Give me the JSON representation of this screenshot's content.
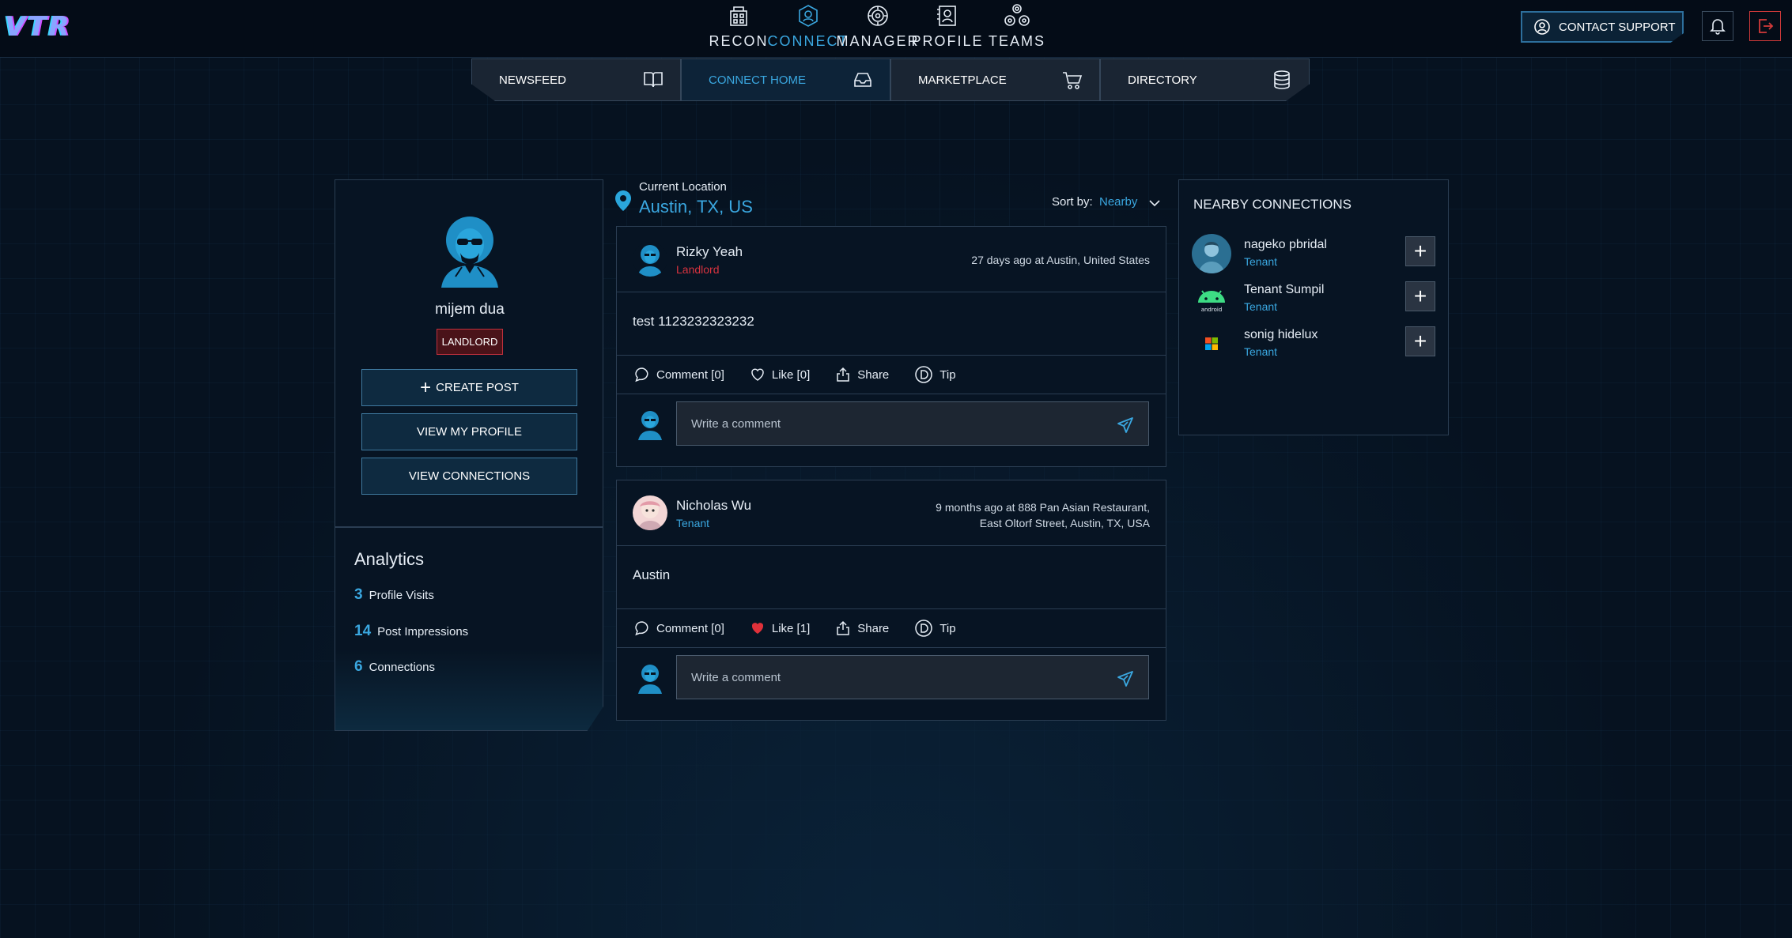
{
  "topbar": {
    "logo_text": "VTR",
    "nav": [
      {
        "label": "RECON",
        "icon": "building-icon",
        "active": false
      },
      {
        "label": "CONNECT",
        "icon": "connect-icon",
        "active": true
      },
      {
        "label": "MANAGER",
        "icon": "manager-icon",
        "active": false
      },
      {
        "label": "PROFILE",
        "icon": "profile-icon",
        "active": false
      },
      {
        "label": "TEAMS",
        "icon": "teams-icon",
        "active": false
      }
    ],
    "support_label": "CONTACT SUPPORT"
  },
  "subnav": [
    {
      "label": "NEWSFEED",
      "icon": "book-icon",
      "active": false
    },
    {
      "label": "CONNECT HOME",
      "icon": "inbox-icon",
      "active": true
    },
    {
      "label": "MARKETPLACE",
      "icon": "cart-icon",
      "active": false
    },
    {
      "label": "DIRECTORY",
      "icon": "database-icon",
      "active": false
    }
  ],
  "profile": {
    "name": "mijem dua",
    "role": "LANDLORD",
    "buttons": {
      "create_post": "CREATE POST",
      "view_profile": "VIEW MY PROFILE",
      "view_connections": "VIEW CONNECTIONS"
    }
  },
  "analytics": {
    "title": "Analytics",
    "stats": [
      {
        "value": "3",
        "label": "Profile Visits"
      },
      {
        "value": "14",
        "label": "Post Impressions"
      },
      {
        "value": "6",
        "label": "Connections"
      }
    ]
  },
  "feed": {
    "location_caption": "Current Location",
    "location": "Austin, TX, US",
    "sort_label": "Sort by:",
    "sort_value": "Nearby",
    "comment_placeholder": "Write a comment",
    "posts": [
      {
        "author": "Rizky Yeah",
        "role": "Landlord",
        "role_color": "#d8333f",
        "meta_line1": "27 days ago at Austin, United States",
        "meta_line2": "",
        "body": "test 1123232323232",
        "comment_label": "Comment [0]",
        "like_label": "Like [0]",
        "liked": false,
        "share_label": "Share",
        "tip_label": "Tip"
      },
      {
        "author": "Nicholas Wu",
        "role": "Tenant",
        "role_color": "#3aa7e0",
        "meta_line1": "9 months ago at 888 Pan Asian Restaurant,",
        "meta_line2": "East Oltorf Street, Austin, TX, USA",
        "body": "Austin",
        "comment_label": "Comment [0]",
        "like_label": "Like [1]",
        "liked": true,
        "share_label": "Share",
        "tip_label": "Tip"
      }
    ]
  },
  "nearby": {
    "title": "NEARBY CONNECTIONS",
    "items": [
      {
        "name": "nageko pbridal",
        "role": "Tenant",
        "avatar": "person-photo"
      },
      {
        "name": "Tenant Sumpil",
        "role": "Tenant",
        "avatar": "android-logo"
      },
      {
        "name": "sonig hidelux",
        "role": "Tenant",
        "avatar": "microsoft-logo"
      }
    ]
  },
  "colors": {
    "accent": "#3aa7e0",
    "landlord": "#d8333f",
    "background": "#061220"
  }
}
